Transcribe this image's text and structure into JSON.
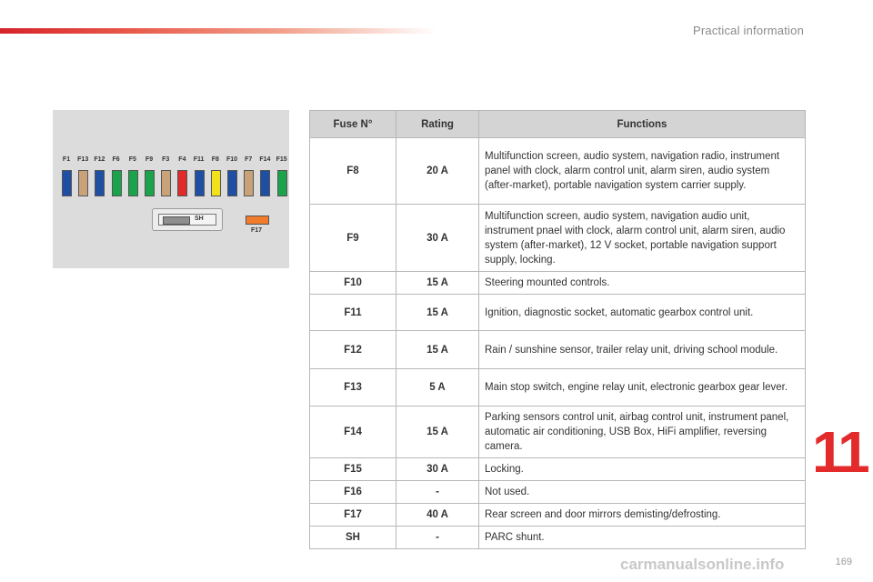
{
  "header": {
    "section_title": "Practical information",
    "accent_color": "#d6232b"
  },
  "chapter_number": "11",
  "page_number": "169",
  "watermark": "carmanualsonline.info",
  "diagram": {
    "fuses": [
      {
        "label": "F1",
        "color": "#1f4fa3"
      },
      {
        "label": "F13",
        "color": "#c9a27a"
      },
      {
        "label": "F12",
        "color": "#1f4fa3"
      },
      {
        "label": "F6",
        "color": "#1aa34a"
      },
      {
        "label": "F5",
        "color": "#1aa34a"
      },
      {
        "label": "F9",
        "color": "#1aa34a"
      },
      {
        "label": "F3",
        "color": "#c9a27a"
      },
      {
        "label": "F4",
        "color": "#e12a2a"
      },
      {
        "label": "F11",
        "color": "#1f4fa3"
      },
      {
        "label": "F8",
        "color": "#f2e21c"
      },
      {
        "label": "F10",
        "color": "#1f4fa3"
      },
      {
        "label": "F7",
        "color": "#c9a27a"
      },
      {
        "label": "F14",
        "color": "#1f4fa3"
      },
      {
        "label": "F15",
        "color": "#1aa34a"
      }
    ],
    "shunt_label": "SH",
    "f17_label": "F17",
    "f17_color": "#f07b2a"
  },
  "table": {
    "headers": [
      "Fuse N°",
      "Rating",
      "Functions"
    ],
    "rows": [
      {
        "fuse": "F8",
        "rating": "20 A",
        "functions": "Multifunction screen, audio system, navigation radio, instrument panel with clock, alarm control unit, alarm siren, audio system (after-market), portable navigation system carrier supply."
      },
      {
        "fuse": "F9",
        "rating": "30 A",
        "functions": "Multifunction screen, audio system, navigation audio unit, instrument pnael with clock, alarm control unit, alarm siren, audio system (after-market), 12 V socket, portable navigation support supply, locking."
      },
      {
        "fuse": "F10",
        "rating": "15 A",
        "functions": "Steering mounted controls."
      },
      {
        "fuse": "F11",
        "rating": "15 A",
        "functions": "Ignition, diagnostic socket, automatic gearbox control unit."
      },
      {
        "fuse": "F12",
        "rating": "15 A",
        "functions": "Rain / sunshine sensor, trailer relay unit, driving school module."
      },
      {
        "fuse": "F13",
        "rating": "5 A",
        "functions": "Main stop switch, engine relay unit, electronic gearbox gear lever."
      },
      {
        "fuse": "F14",
        "rating": "15 A",
        "functions": "Parking sensors control unit, airbag control unit, instrument panel, automatic air conditioning, USB Box, HiFi amplifier, reversing camera."
      },
      {
        "fuse": "F15",
        "rating": "30 A",
        "functions": "Locking."
      },
      {
        "fuse": "F16",
        "rating": "-",
        "functions": "Not used."
      },
      {
        "fuse": "F17",
        "rating": "40 A",
        "functions": "Rear screen and door mirrors demisting/defrosting."
      },
      {
        "fuse": "SH",
        "rating": "-",
        "functions": "PARC shunt."
      }
    ]
  }
}
